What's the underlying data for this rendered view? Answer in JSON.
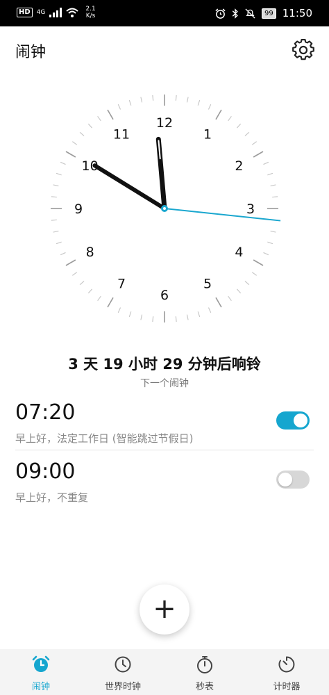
{
  "statusbar": {
    "hd": "HD",
    "network": "4G",
    "rate_value": "2.1",
    "rate_unit": "K/s",
    "battery": "99",
    "time": "11:50"
  },
  "header": {
    "title": "闹钟",
    "settings_icon": "gear-icon"
  },
  "clock": {
    "numerals": [
      "12",
      "1",
      "2",
      "3",
      "4",
      "5",
      "6",
      "7",
      "8",
      "9",
      "10",
      "11"
    ],
    "hour": 11,
    "minute": 50,
    "second": 16,
    "second_hand_color": "#1aa7cf"
  },
  "next_alarm": {
    "countdown": "3 天 19 小时 29 分钟后响铃",
    "label": "下一个闹钟"
  },
  "alarms": [
    {
      "time": "07:20",
      "description": "早上好，法定工作日 (智能跳过节假日)",
      "enabled": true
    },
    {
      "time": "09:00",
      "description": "早上好，不重复",
      "enabled": false
    }
  ],
  "fab": {
    "label": "+"
  },
  "nav": {
    "items": [
      {
        "label": "闹钟",
        "icon": "alarm-clock-icon",
        "active": true
      },
      {
        "label": "世界时钟",
        "icon": "world-clock-icon",
        "active": false
      },
      {
        "label": "秒表",
        "icon": "stopwatch-icon",
        "active": false
      },
      {
        "label": "计时器",
        "icon": "timer-icon",
        "active": false
      }
    ]
  },
  "colors": {
    "accent": "#15a6cf",
    "toggle_off": "#d7d7d7",
    "text_secondary": "#888888"
  }
}
